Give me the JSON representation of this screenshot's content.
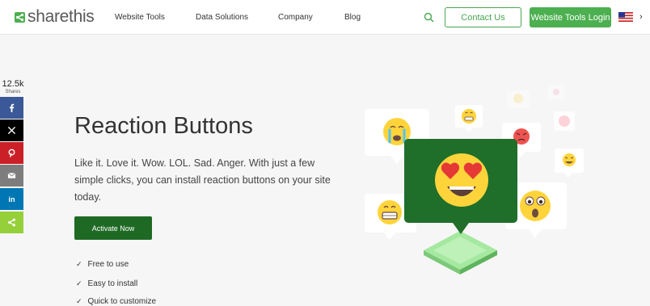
{
  "brand": {
    "name": "sharethis",
    "color": "#4caf50"
  },
  "nav": {
    "items": [
      {
        "label": "Website Tools"
      },
      {
        "label": "Data Solutions"
      },
      {
        "label": "Company"
      },
      {
        "label": "Blog"
      }
    ],
    "search_icon": "search-icon",
    "contact_label": "Contact Us",
    "login_label": "Website Tools Login",
    "language_flag": "us-flag-icon"
  },
  "share_bar": {
    "count": "12.5k",
    "count_label": "Shares",
    "buttons": [
      {
        "network": "facebook",
        "icon": "facebook-icon",
        "color": "#3b5998"
      },
      {
        "network": "x",
        "icon": "x-icon",
        "color": "#000000"
      },
      {
        "network": "pinterest",
        "icon": "pinterest-icon",
        "color": "#cb2027"
      },
      {
        "network": "email",
        "icon": "email-icon",
        "color": "#7d7d7d"
      },
      {
        "network": "linkedin",
        "icon": "linkedin-icon",
        "color": "#0077b5"
      },
      {
        "network": "sharethis",
        "icon": "share-icon",
        "color": "#95d03a"
      }
    ]
  },
  "hero": {
    "title": "Reaction Buttons",
    "description": "Like it. Love it. Wow. LOL. Sad. Anger. With just a few simple clicks, you can install reaction buttons on your site today.",
    "cta_label": "Activate Now",
    "features": [
      "Free to use",
      "Easy to install",
      "Quick to customize"
    ]
  },
  "colors": {
    "accent": "#46a74e",
    "cta_dark": "#1e6a24",
    "illustration_green": "#1f6f2a",
    "emoji_yellow": "#ffd43b"
  }
}
